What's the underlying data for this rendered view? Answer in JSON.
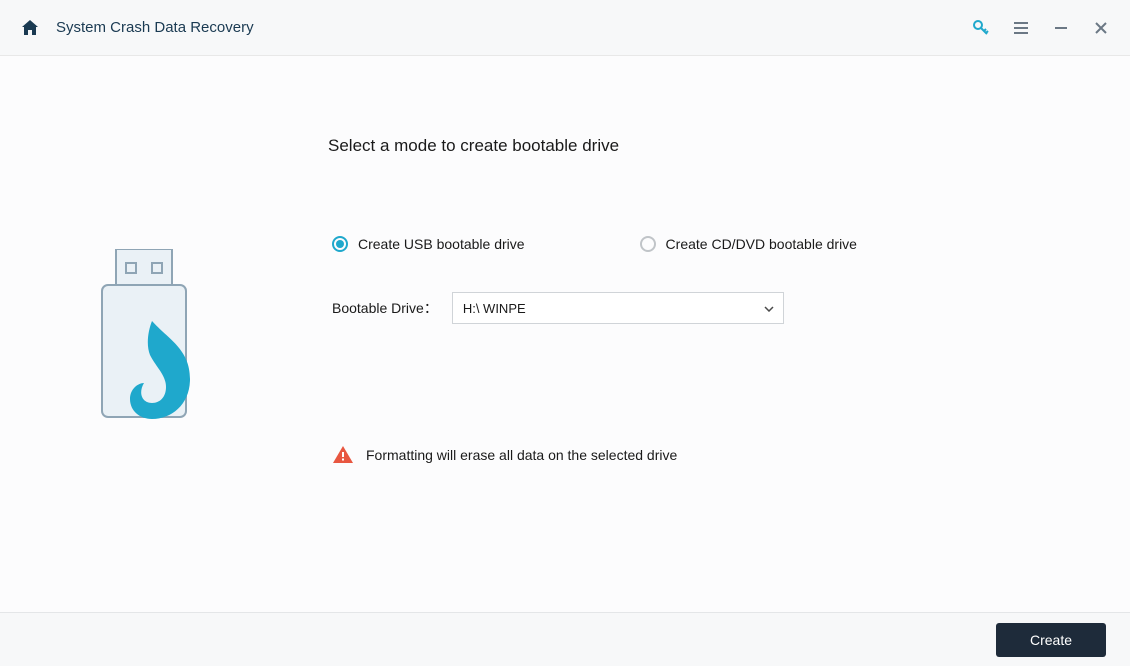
{
  "titlebar": {
    "title": "System Crash Data Recovery"
  },
  "main": {
    "heading": "Select a mode to create bootable drive",
    "radio_usb_label": "Create USB bootable drive",
    "radio_cddvd_label": "Create CD/DVD bootable drive",
    "drive_label": "Bootable Drive：",
    "drive_value": "H:\\ WINPE",
    "warning_text": "Formatting will erase all data on the selected drive"
  },
  "footer": {
    "create_label": "Create"
  }
}
